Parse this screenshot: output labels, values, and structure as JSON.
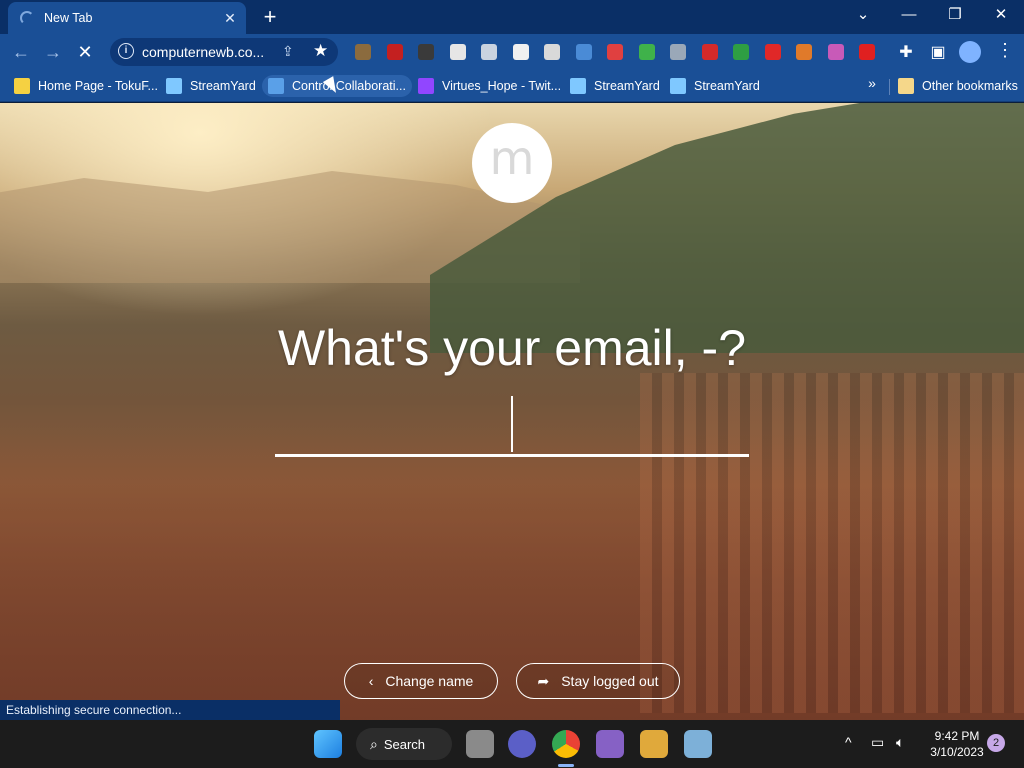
{
  "browser": {
    "tab": {
      "title": "New Tab",
      "close_icon": "close-icon",
      "status": "loading"
    },
    "new_tab_icon": "+",
    "window_controls": [
      "⌄",
      "—",
      "❐",
      "✕"
    ],
    "omnibox": {
      "url": "computernewb.co..."
    },
    "profile_icon": "avatar",
    "menu_icon": "⋮"
  },
  "bookmarks": [
    {
      "label": "Home Page - TokuF...",
      "color": "#f5d142"
    },
    {
      "label": "StreamYard",
      "color": "#7fc8ff"
    },
    {
      "label": "Control Collaborati...",
      "color": "#5aa0e8"
    },
    {
      "label": "Virtues_Hope - Twit...",
      "color": "#9146ff"
    },
    {
      "label": "StreamYard",
      "color": "#7fc8ff"
    },
    {
      "label": "StreamYard",
      "color": "#7fc8ff"
    }
  ],
  "other_bookmarks": "Other bookmarks",
  "extensions": [
    {
      "name": "ext-k-icon",
      "color": "#8b6b3e"
    },
    {
      "name": "ext-red-icon",
      "color": "#c42020"
    },
    {
      "name": "ext-dark-icon",
      "color": "#3a3a3a"
    },
    {
      "name": "ext-white-icon",
      "color": "#e6e6e6"
    },
    {
      "name": "ext-id-icon",
      "color": "#c9d3e0"
    },
    {
      "name": "ext-crl-icon",
      "color": "#f0f0f0"
    },
    {
      "name": "ext-shield-icon",
      "color": "#d9d9d9"
    },
    {
      "name": "ext-blue-icon",
      "color": "#4a8bd6"
    },
    {
      "name": "ext-arrows-icon",
      "color": "#e04040"
    },
    {
      "name": "ext-green-icon",
      "color": "#3fb24a"
    },
    {
      "name": "ext-tool-icon",
      "color": "#9aa8b8"
    },
    {
      "name": "ext-redbox-icon",
      "color": "#d42a2a"
    },
    {
      "name": "ext-dollar-icon",
      "color": "#2e9e43"
    },
    {
      "name": "ext-redsq-icon",
      "color": "#e02828"
    },
    {
      "name": "ext-badge-icon",
      "color": "#e07a2a"
    },
    {
      "name": "ext-grid-icon",
      "color": "#c85ab8"
    },
    {
      "name": "ext-youtube-icon",
      "color": "#e02020"
    }
  ],
  "page": {
    "logo_letter": "m",
    "headline": "What's your email, -?",
    "email_value": "",
    "buttons": {
      "change_name": "Change name",
      "stay_logged_out": "Stay logged out"
    }
  },
  "status_bar": "Establishing secure connection...",
  "taskbar": {
    "search_label": "Search",
    "time": "9:42 PM",
    "date": "3/10/2023",
    "notification_count": "2"
  }
}
